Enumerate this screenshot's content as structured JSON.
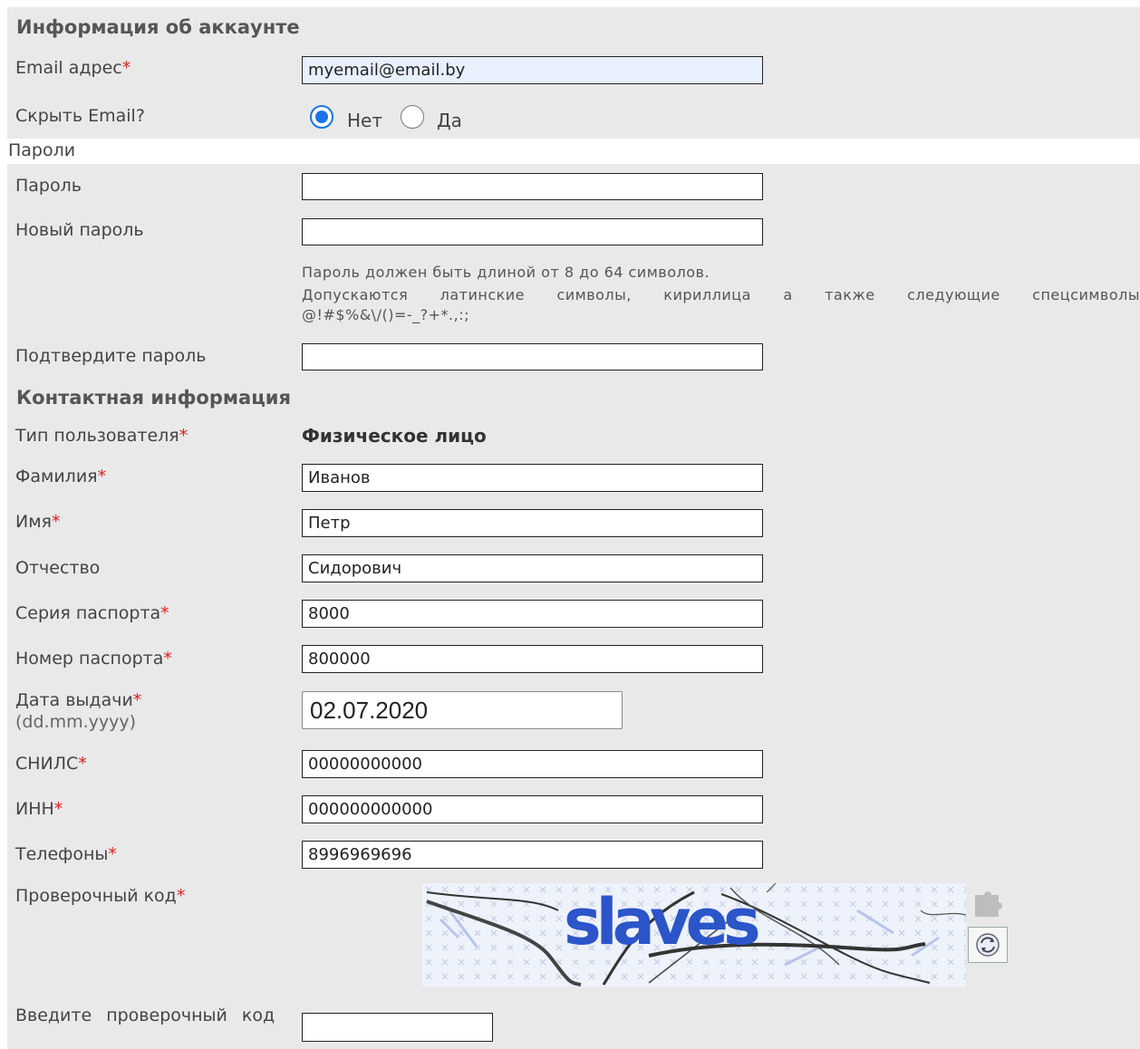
{
  "account": {
    "title": "Информация об аккаунте",
    "email_label": "Email адрес",
    "email_value": "myemail@email.by",
    "hide_email_label": "Скрыть Email?",
    "hide_no": "Нет",
    "hide_yes": "Да"
  },
  "passwords": {
    "title": "Пароли",
    "password_label": "Пароль",
    "new_password_label": "Новый пароль",
    "hint_line1": "Пароль должен быть длиной от 8 до 64 символов.",
    "hint_line2": "Допускаются латинские символы, кириллица а также следующие спецсимволы",
    "hint_line3": "@!#$%&\\/()=-_?+*.,:;",
    "confirm_label": "Подтвердите пароль"
  },
  "contact": {
    "title": "Контактная информация",
    "user_type_label": "Тип пользователя",
    "user_type_value": "Физическое лицо",
    "last_name_label": "Фамилия",
    "last_name_value": "Иванов",
    "first_name_label": "Имя",
    "first_name_value": "Петр",
    "patronymic_label": "Отчество",
    "patronymic_value": "Сидорович",
    "passport_series_label": "Серия паспорта",
    "passport_series_value": "8000",
    "passport_number_label": "Номер паспорта",
    "passport_number_value": "800000",
    "issue_date_label": "Дата выдачи",
    "issue_date_format": "(dd.mm.yyyy)",
    "issue_date_value": "02.07.2020",
    "snils_label": "СНИЛС",
    "snils_value": "00000000000",
    "inn_label": "ИНН",
    "inn_value": "000000000000",
    "phones_label": "Телефоны",
    "phones_value": "8996969696",
    "captcha_label": "Проверочный код",
    "captcha_text": "slaves",
    "captcha_input_label": "Введите проверочный код",
    "captcha_input_value": ""
  },
  "required_mark": "*",
  "colors": {
    "panel": "#e9e9e9",
    "required": "#e02020",
    "accent": "#1a73e8",
    "captcha_text": "#2b55c9"
  }
}
